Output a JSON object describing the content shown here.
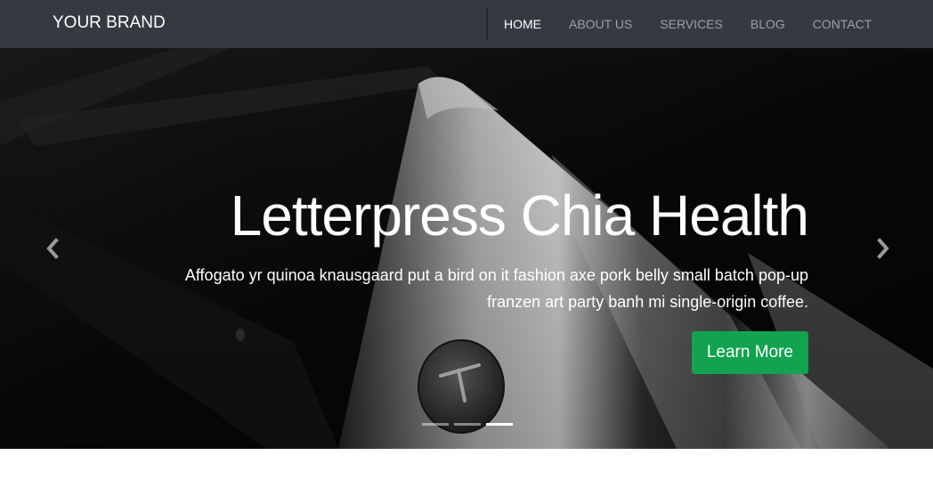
{
  "navbar": {
    "brand": "YOUR BRAND",
    "links": [
      {
        "label": "HOME",
        "active": true
      },
      {
        "label": "ABOUT US",
        "active": false
      },
      {
        "label": "SERVICES",
        "active": false
      },
      {
        "label": "BLOG",
        "active": false
      },
      {
        "label": "CONTACT",
        "active": false
      }
    ]
  },
  "hero": {
    "title": "Letterpress Chia Health",
    "subtitle": "Affogato yr quinoa knausgaard put a bird on it fashion axe pork belly small batch pop-up franzen art party banh mi single-origin coffee.",
    "button_label": "Learn More",
    "prev_icon": "chevron-left-icon",
    "next_icon": "chevron-right-icon",
    "slides_count": 3,
    "active_slide": 3
  },
  "colors": {
    "navbar_bg": "#343a40",
    "accent_button": "#12a34f",
    "nav_link": "#9aa0a6",
    "nav_link_active": "#ffffff"
  }
}
